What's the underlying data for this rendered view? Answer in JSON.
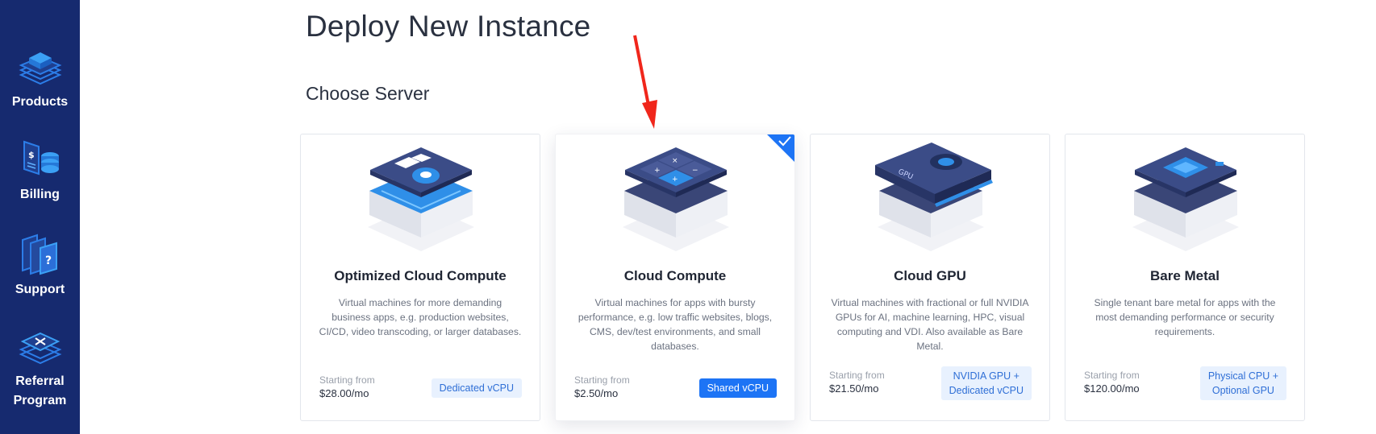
{
  "sidebar": {
    "items": [
      {
        "label": "Products",
        "icon": "layers-cube-icon"
      },
      {
        "label": "Billing",
        "icon": "billing-coins-icon"
      },
      {
        "label": "Support",
        "icon": "support-question-icon"
      },
      {
        "label": "Referral\nProgram",
        "icon": "referral-arrows-icon"
      }
    ]
  },
  "page": {
    "title": "Deploy New Instance",
    "section_title": "Choose Server"
  },
  "cards": [
    {
      "title": "Optimized Cloud Compute",
      "description": "Virtual machines for more demanding business apps, e.g. production websites, CI/CD, video transcoding, or larger databases.",
      "starting_label": "Starting from",
      "price": "$28.00/mo",
      "badge": "Dedicated vCPU",
      "selected": false
    },
    {
      "title": "Cloud Compute",
      "description": "Virtual machines for apps with bursty performance, e.g. low traffic websites, blogs, CMS, dev/test environments, and small databases.",
      "starting_label": "Starting from",
      "price": "$2.50/mo",
      "badge": "Shared vCPU",
      "selected": true
    },
    {
      "title": "Cloud GPU",
      "description": "Virtual machines with fractional or full NVIDIA GPUs for AI, machine learning, HPC, visual computing and VDI. Also available as Bare Metal.",
      "starting_label": "Starting from",
      "price": "$21.50/mo",
      "badge": "NVIDIA GPU +\nDedicated vCPU",
      "selected": false
    },
    {
      "title": "Bare Metal",
      "description": "Single tenant bare metal for apps with the most demanding performance or security requirements.",
      "starting_label": "Starting from",
      "price": "$120.00/mo",
      "badge": "Physical CPU +\nOptional GPU",
      "selected": false
    }
  ],
  "colors": {
    "sidebar_bg": "#162a6f",
    "accent": "#1d74f5",
    "annotation_arrow": "#f0261b"
  }
}
